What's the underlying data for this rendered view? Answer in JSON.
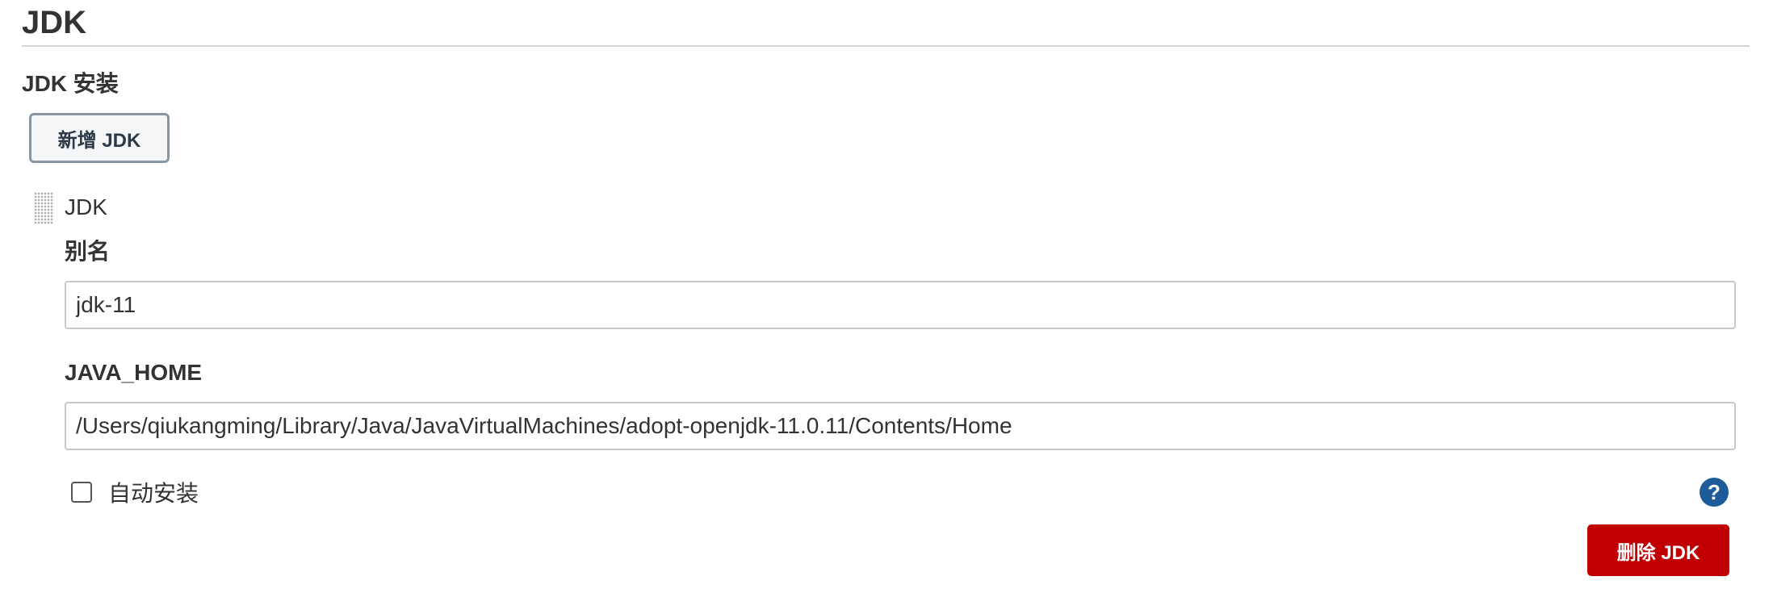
{
  "section": {
    "title": "JDK"
  },
  "installations": {
    "label": "JDK 安装",
    "add_button_label": "新增 JDK"
  },
  "jdk_item": {
    "title": "JDK",
    "alias_label": "别名",
    "alias_value": "jdk-11",
    "java_home_label": "JAVA_HOME",
    "java_home_value": "/Users/qiukangming/Library/Java/JavaVirtualMachines/adopt-openjdk-11.0.11/Contents/Home",
    "auto_install_label": "自动安装",
    "auto_install_checked": false,
    "help_icon": "question-mark-icon",
    "help_glyph": "?",
    "delete_button_label": "删除 JDK"
  },
  "colors": {
    "delete_button": "#c00000",
    "help_icon": "#1d5c99",
    "add_button_border": "#8a96a3"
  }
}
